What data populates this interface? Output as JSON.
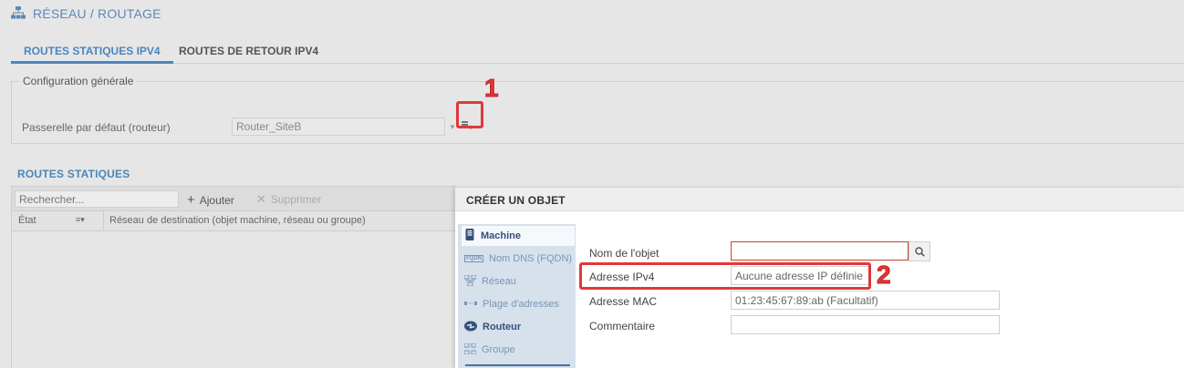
{
  "header": {
    "title": "RÉSEAU / ROUTAGE",
    "icon": "network-icon"
  },
  "tabs": [
    {
      "label": "ROUTES STATIQUES IPV4",
      "active": true
    },
    {
      "label": "ROUTES DE RETOUR IPV4",
      "active": false
    }
  ],
  "general": {
    "legend": "Configuration générale",
    "gateway_label": "Passerelle par défaut (routeur)",
    "gateway_value": "Router_SiteB"
  },
  "annotations": {
    "badge1": "1",
    "badge2": "2",
    "color": "#e0383a"
  },
  "routes": {
    "title": "ROUTES STATIQUES",
    "search_placeholder": "Rechercher...",
    "add_label": "Ajouter",
    "delete_label": "Supprimer",
    "columns": [
      "État",
      "Réseau de destination (objet machine, réseau ou groupe)"
    ]
  },
  "dialog": {
    "title": "CRÉER UN OBJET",
    "sidebar": [
      {
        "label": "Machine",
        "icon": "machine-icon",
        "active": true
      },
      {
        "label": "Nom DNS (FQDN)",
        "icon": "fqdn-icon",
        "active": false
      },
      {
        "label": "Réseau",
        "icon": "network-icon",
        "active": false
      },
      {
        "label": "Plage d'adresses",
        "icon": "address-range-icon",
        "active": false
      },
      {
        "label": "Routeur",
        "icon": "router-icon",
        "active": false
      },
      {
        "label": "Groupe",
        "icon": "group-icon",
        "active": false
      }
    ],
    "fields": {
      "name_label": "Nom de l'objet",
      "name_value": "",
      "ipv4_label": "Adresse IPv4",
      "ipv4_value": "Aucune adresse IP définie",
      "mac_label": "Adresse MAC",
      "mac_value": "01:23:45:67:89:ab (Facultatif)",
      "comment_label": "Commentaire",
      "comment_value": ""
    }
  },
  "colors": {
    "accent": "#4a86bf",
    "highlight": "#e0383a",
    "sidebar_bg": "#d6e1ec"
  }
}
